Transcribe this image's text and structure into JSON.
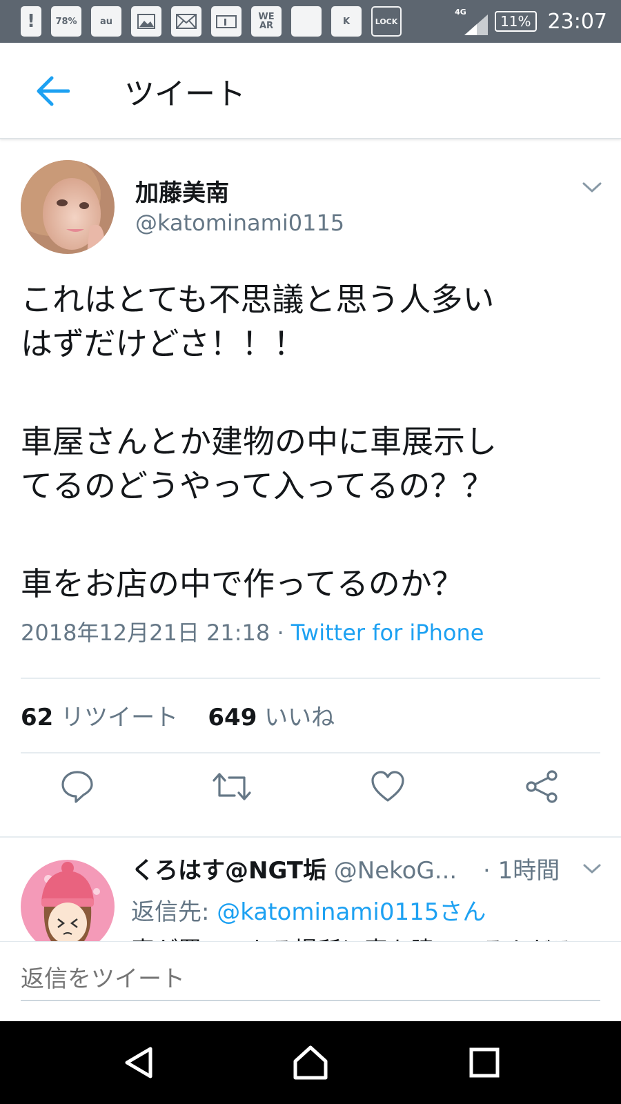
{
  "status_bar": {
    "icons": [
      {
        "name": "alert-icon",
        "text": "!"
      },
      {
        "name": "mobile-data-icon",
        "text": "78%"
      },
      {
        "name": "au-mail-icon",
        "text": "au"
      },
      {
        "name": "gallery-icon",
        "text": ""
      },
      {
        "name": "mail-icon",
        "text": ""
      },
      {
        "name": "info-card-icon",
        "text": ""
      },
      {
        "name": "wear-icon",
        "text": "WE AR"
      },
      {
        "name": "blank-app-icon",
        "text": ""
      },
      {
        "name": "k-app-icon",
        "text": "K"
      },
      {
        "name": "lock-icon",
        "text": "LOCK"
      }
    ],
    "network": "4G",
    "battery": "11%",
    "time": "23:07"
  },
  "header": {
    "title": "ツイート"
  },
  "tweet": {
    "author_name": "加藤美南",
    "author_handle": "@katominami0115",
    "text_lines": [
      "これはとても不思議と思う人多い",
      "はずだけどさ！！！",
      "",
      "車屋さんとか建物の中に車展示し",
      "てるのどうやって入ってるの？？",
      "",
      "車をお店の中で作ってるのか？"
    ],
    "timestamp": "2018年12月21日 21:18",
    "separator": " · ",
    "source": "Twitter for iPhone",
    "retweet_count": "62",
    "retweet_label": "リツイート",
    "like_count": "649",
    "like_label": "いいね"
  },
  "reply": {
    "name": "くろはす@NGT垢",
    "handle": "@NekoG...",
    "time": "· 1時間",
    "reply_to_label": "返信先: ",
    "reply_to_handle": "@katominami0115さん",
    "body_preview": "車が置いてある場所に車を建ててるんだろ"
  },
  "composer": {
    "placeholder": "返信をツイート"
  },
  "colors": {
    "accent": "#1da1f2",
    "secondary_text": "#657786",
    "status_bar": "#5d6670"
  }
}
